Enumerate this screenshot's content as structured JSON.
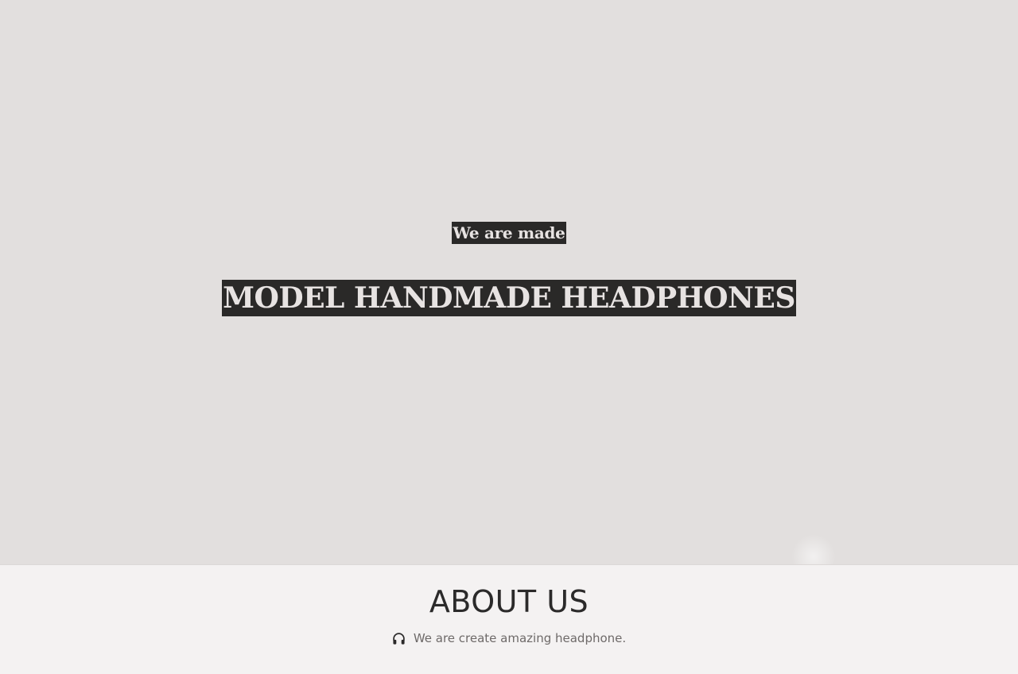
{
  "hero": {
    "kicker": "We are made",
    "title": "MODEL HANDMADE HEADPHONES"
  },
  "about": {
    "title": "ABOUT US",
    "tagline": "We are create amazing headphone.",
    "tagline_icon": "headphones-icon"
  },
  "colors": {
    "hero_background": "#e2dfde",
    "highlight_background": "#2a2928",
    "highlight_text": "#e7e3e2",
    "about_background": "#f4f2f2",
    "heading_text": "#2b2a2a",
    "body_text": "#6e6a69"
  }
}
